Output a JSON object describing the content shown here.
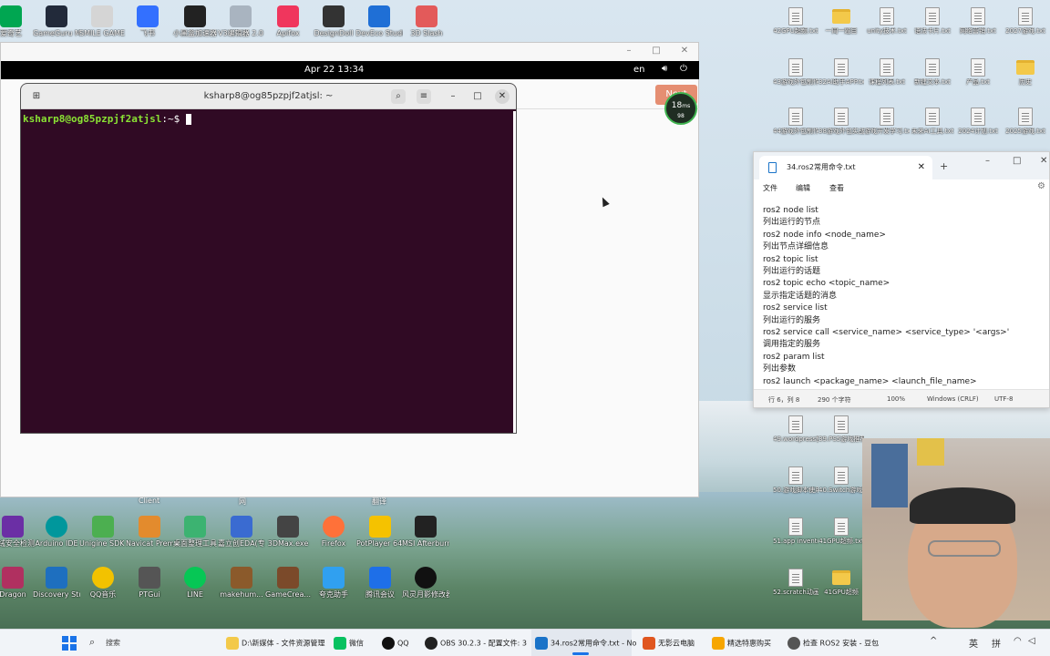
{
  "desktop": {
    "top_icons": [
      {
        "label": "爱奇艺",
        "color": "#00a651"
      },
      {
        "label": "GameGuru MAX",
        "color": "#222a3a"
      },
      {
        "label": "SMILE GAME",
        "color": "#d5d5d5"
      },
      {
        "label": "飞书",
        "color": "#3370ff"
      },
      {
        "label": "小黑盒加速器",
        "color": "#222"
      },
      {
        "label": "V3编辑器 2.0",
        "color": "#a9b4c0"
      },
      {
        "label": "Apifox",
        "color": "#f0365d"
      },
      {
        "label": "DesignDoll",
        "color": "#333"
      },
      {
        "label": "DevEco Studio",
        "color": "#1f6fd6"
      },
      {
        "label": "3D Slash",
        "color": "#e35a5a"
      }
    ],
    "right_icons": [
      {
        "label": "42GPU超频.txt",
        "type": "doc"
      },
      {
        "label": "一周一题目",
        "type": "folder"
      },
      {
        "label": "unity技术.txt",
        "type": "doc"
      },
      {
        "label": "语法卡片.txt",
        "type": "doc"
      },
      {
        "label": "网络营销.txt",
        "type": "doc"
      },
      {
        "label": "2027游戏.txt",
        "type": "doc"
      },
      {
        "label": "43游戏外包制作.txt",
        "type": "doc"
      },
      {
        "label": "32AI助手APP.txt",
        "type": "doc"
      },
      {
        "label": "课程列表.txt",
        "type": "doc"
      },
      {
        "label": "新建文本.txt",
        "type": "doc"
      },
      {
        "label": "产品.txt",
        "type": "doc"
      },
      {
        "label": "历史",
        "type": "folder"
      },
      {
        "label": "44游戏外包制作.txt",
        "type": "doc"
      },
      {
        "label": "38游戏外包实战.txt",
        "type": "doc"
      },
      {
        "label": "游戏开发学习.txt",
        "type": "doc"
      },
      {
        "label": "未来AI工具.txt",
        "type": "doc"
      },
      {
        "label": "2024计划.txt",
        "type": "doc"
      },
      {
        "label": "2025游戏.txt",
        "type": "doc"
      },
      {
        "label": "49.wordpress使用.txt",
        "type": "doc"
      },
      {
        "label": "39.PS5游戏推荐.txt",
        "type": "doc"
      },
      {
        "label": "50.游戏脚本使用.txt",
        "type": "doc"
      },
      {
        "label": "40.Switch游戏推荐.txt",
        "type": "doc"
      },
      {
        "label": "51.app inventor.txt",
        "type": "doc"
      },
      {
        "label": "41GPU超频.txt",
        "type": "doc"
      },
      {
        "label": "52.scratch动画设计.txt",
        "type": "doc"
      },
      {
        "label": "41GPU超频",
        "type": "folder"
      }
    ],
    "bottom_icons_row1": [
      {
        "label": "火绒安全检测",
        "color": "#6b2fa5"
      },
      {
        "label": "Arduino IDE",
        "color": "#00979c"
      },
      {
        "label": "Unigine SDK browser 2",
        "color": "#4caf50"
      },
      {
        "label": "Navicat Premium",
        "color": "#e38b2d"
      },
      {
        "label": "桌面整理工具",
        "color": "#3cb371"
      },
      {
        "label": "嘉立创EDA(专业版)",
        "color": "#3a6bd1"
      },
      {
        "label": "3DMax.exe",
        "color": "#444"
      },
      {
        "label": "Firefox",
        "color": "#ff7139"
      },
      {
        "label": "PotPlayer 64 bit",
        "color": "#f5c200"
      },
      {
        "label": "MSI Afterburner",
        "color": "#222"
      }
    ],
    "bottom_icons_row2": [
      {
        "label": "Dragon",
        "color": "#b03060"
      },
      {
        "label": "Discovery Studio 20...",
        "color": "#1e6fbf"
      },
      {
        "label": "QQ音乐",
        "color": "#f2c200"
      },
      {
        "label": "PTGui",
        "color": "#555"
      },
      {
        "label": "LINE",
        "color": "#06c755"
      },
      {
        "label": "makehum...",
        "color": "#8b5a2b"
      },
      {
        "label": "GameCrea...",
        "color": "#7b4a2a"
      },
      {
        "label": "夸克助手",
        "color": "#30a0f0"
      },
      {
        "label": "腾讯会议",
        "color": "#1e6fe8"
      },
      {
        "label": "风灵月影修改器",
        "color": "#111"
      }
    ],
    "partial_labels": [
      "Client",
      "网",
      "翻译"
    ]
  },
  "vm": {
    "clock": "Apr 22  13:34",
    "lang": "en",
    "next_button": "Next",
    "perf": {
      "fps": "18",
      "unit": "ms",
      "sub": "98"
    }
  },
  "terminal": {
    "title": "ksharp8@og85pzpjf2atjsl: ~",
    "prompt_user": "ksharp8@og85pzpjf2atjsl",
    "prompt_rest": ":~$ "
  },
  "notepad": {
    "tab_title": "34.ros2常用命令.txt",
    "menu": [
      "文件",
      "编辑",
      "查看"
    ],
    "lines": [
      "ros2 node list",
      "列出运行的节点",
      "ros2 node info <node_name>",
      "列出节点详细信息",
      "ros2 topic list",
      "列出运行的话题",
      "ros2 topic echo <topic_name>",
      "显示指定话题的消息",
      "ros2 service list",
      "列出运行的服务",
      "ros2 service call <service_name> <service_type> '<args>'",
      "调用指定的服务",
      "ros2 param list",
      "列出参数",
      "ros2 launch <package_name> <launch_file_name>"
    ],
    "status": {
      "position": "行 6，列 8",
      "chars": "290 个字符",
      "zoom": "100%",
      "eol": "Windows (CRLF)",
      "encoding": "UTF-8"
    }
  },
  "taskbar": {
    "search_label": "搜索",
    "items": [
      {
        "label": "D:\\新媒体 - 文件资源管理",
        "color": "#f3c94a"
      },
      {
        "label": "微信",
        "color": "#07c160"
      },
      {
        "label": "QQ",
        "color": "#111"
      },
      {
        "label": "OBS 30.2.3 - 配置文件: 3",
        "color": "#222"
      },
      {
        "label": "34.ros2常用命令.txt - No",
        "color": "#1a73c8"
      },
      {
        "label": "无影云电脑",
        "color": "#e0561f"
      },
      {
        "label": "精选特惠购买",
        "color": "#f7a600"
      },
      {
        "label": "检查 ROS2 安装 - 豆包",
        "color": "#555"
      }
    ],
    "tray": [
      "^",
      "英",
      "拼"
    ]
  }
}
